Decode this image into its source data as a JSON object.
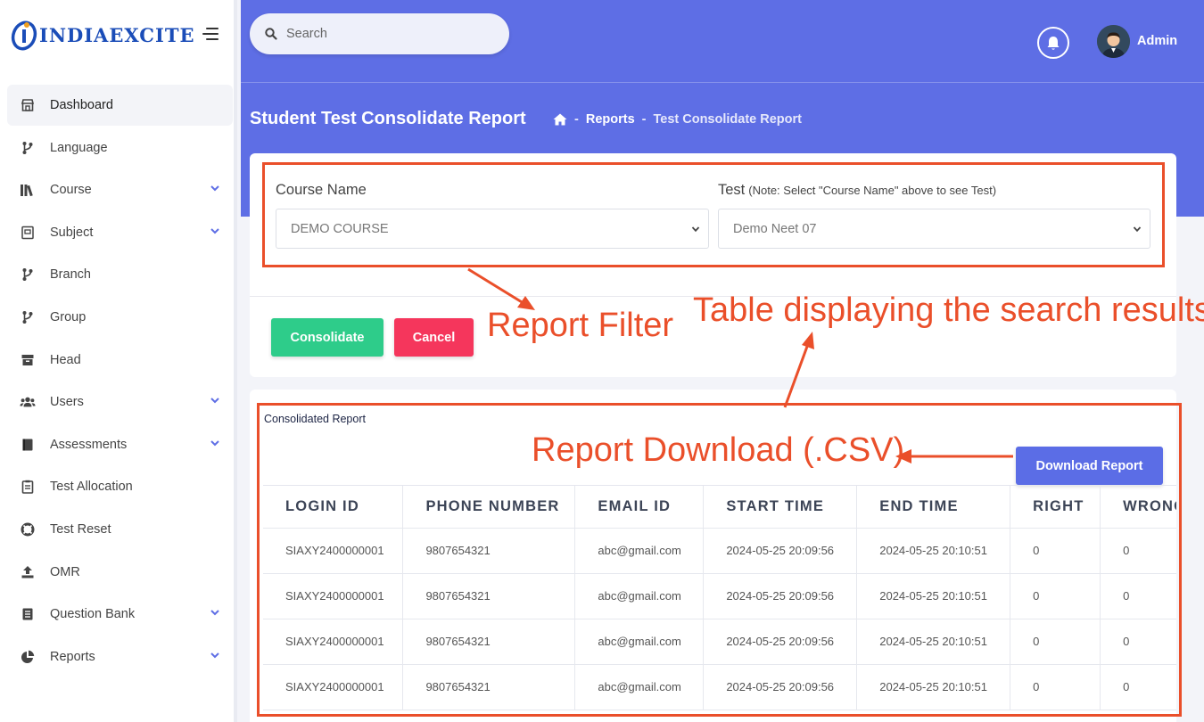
{
  "brand": {
    "name": "INDIAEXCITE",
    "color": "#1b4db8"
  },
  "search": {
    "placeholder": "Search"
  },
  "header": {
    "user_name": "Admin",
    "bg_color": "#5e6ee5"
  },
  "page": {
    "title": "Student Test Consolidate Report",
    "breadcrumb": {
      "reports": "Reports",
      "current": "Test Consolidate Report"
    }
  },
  "sidebar": {
    "items": [
      {
        "label": "Dashboard",
        "icon": "store-icon",
        "has_submenu": false,
        "active": true
      },
      {
        "label": "Language",
        "icon": "branch-icon",
        "has_submenu": false
      },
      {
        "label": "Course",
        "icon": "books-icon",
        "has_submenu": true
      },
      {
        "label": "Subject",
        "icon": "book-icon",
        "has_submenu": true
      },
      {
        "label": "Branch",
        "icon": "branch-icon",
        "has_submenu": false
      },
      {
        "label": "Group",
        "icon": "branch-icon",
        "has_submenu": false
      },
      {
        "label": "Head",
        "icon": "box-icon",
        "has_submenu": false
      },
      {
        "label": "Users",
        "icon": "users-icon",
        "has_submenu": true
      },
      {
        "label": "Assessments",
        "icon": "notebook-icon",
        "has_submenu": true
      },
      {
        "label": "Test Allocation",
        "icon": "clipboard-icon",
        "has_submenu": false
      },
      {
        "label": "Test Reset",
        "icon": "lifebuoy-icon",
        "has_submenu": false
      },
      {
        "label": "OMR",
        "icon": "upload-icon",
        "has_submenu": false
      },
      {
        "label": "Question Bank",
        "icon": "list-icon",
        "has_submenu": true
      },
      {
        "label": "Reports",
        "icon": "pie-chart-icon",
        "has_submenu": true
      }
    ]
  },
  "filter": {
    "course_label": "Course Name",
    "course_value": "DEMO COURSE",
    "test_label": "Test",
    "test_note": "(Note: Select \"Course Name\" above to see Test)",
    "test_value": "Demo Neet 07",
    "consolidate_label": "Consolidate",
    "cancel_label": "Cancel",
    "consolidate_color": "#2ecc8a",
    "cancel_color": "#f5365c"
  },
  "report": {
    "title": "Consolidated Report",
    "download_label": "Download Report",
    "columns": [
      "LOGIN ID",
      "PHONE NUMBER",
      "EMAIL ID",
      "START TIME",
      "END TIME",
      "RIGHT",
      "WRONG"
    ],
    "rows": [
      [
        "SIAXY2400000001",
        "9807654321",
        "abc@gmail.com",
        "2024-05-25 20:09:56",
        "2024-05-25 20:10:51",
        "0",
        "0"
      ],
      [
        "SIAXY2400000001",
        "9807654321",
        "abc@gmail.com",
        "2024-05-25 20:09:56",
        "2024-05-25 20:10:51",
        "0",
        "0"
      ],
      [
        "SIAXY2400000001",
        "9807654321",
        "abc@gmail.com",
        "2024-05-25 20:09:56",
        "2024-05-25 20:10:51",
        "0",
        "0"
      ],
      [
        "SIAXY2400000001",
        "9807654321",
        "abc@gmail.com",
        "2024-05-25 20:09:56",
        "2024-05-25 20:10:51",
        "0",
        "0"
      ]
    ]
  },
  "annotations": {
    "report_filter": "Report Filter",
    "table_results": "Table displaying the search results",
    "report_download": "Report Download (.CSV)",
    "color": "#ea4f2a"
  }
}
